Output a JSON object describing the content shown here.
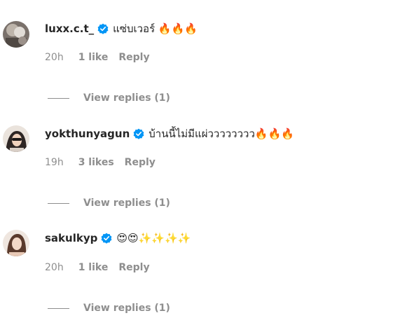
{
  "comments": [
    {
      "username": "luxx.c.t_",
      "text": "แซ่บเวอร์ 🔥🔥🔥",
      "time": "20h",
      "likes": "1 like",
      "reply_label": "Reply",
      "view_replies": "View replies (1)"
    },
    {
      "username": "yokthunyagun",
      "text": "บ้านนี้ไม่มีแผ่วววววววว🔥🔥🔥",
      "time": "19h",
      "likes": "3 likes",
      "reply_label": "Reply",
      "view_replies": "View replies (1)"
    },
    {
      "username": "sakulkyp",
      "text": "😍😍✨✨✨✨",
      "time": "20h",
      "likes": "1 like",
      "reply_label": "Reply",
      "view_replies": "View replies (1)"
    }
  ],
  "colors": {
    "text_primary": "#262626",
    "text_secondary": "#8e8e8e",
    "verified_blue": "#0095f6"
  }
}
